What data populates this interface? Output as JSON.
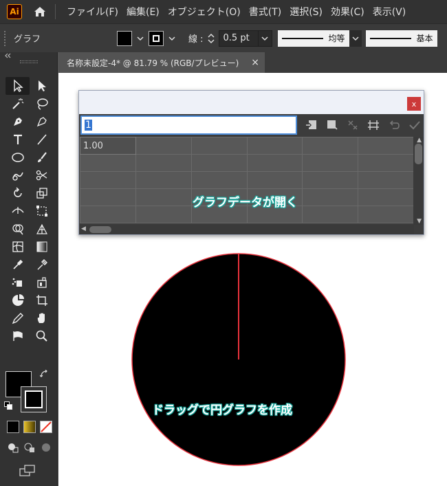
{
  "app": {
    "logo": "Ai"
  },
  "menu": [
    "ファイル(F)",
    "編集(E)",
    "オブジェクト(O)",
    "書式(T)",
    "選択(S)",
    "効果(C)",
    "表示(V)"
  ],
  "control_bar": {
    "selection_label": "グラフ",
    "stroke_label": "線 :",
    "stroke_weight": "0.5 pt",
    "profile_label": "均等",
    "brush_label": "基本"
  },
  "document_tab": {
    "title": "名称未設定-4* @ 81.79 % (RGB/プレビュー)",
    "close": "×"
  },
  "graph_dialog": {
    "close_label": "x",
    "input_value": "1",
    "cells": [
      [
        "1.00",
        "",
        "",
        "",
        "",
        ""
      ],
      [
        "",
        "",
        "",
        "",
        "",
        ""
      ],
      [
        "",
        "",
        "",
        "",
        "",
        ""
      ],
      [
        "",
        "",
        "",
        "",
        "",
        ""
      ],
      [
        "",
        "",
        "",
        "",
        "",
        ""
      ]
    ]
  },
  "annotations": {
    "dialog_note": "グラフデータが開く",
    "pie_note": "ドラッグで円グラフを作成"
  },
  "colors": {
    "accent": "#1aa89e",
    "pie_fill": "#000000",
    "pie_stroke": "#e8323c",
    "dialog_close": "#cc3a3a"
  }
}
